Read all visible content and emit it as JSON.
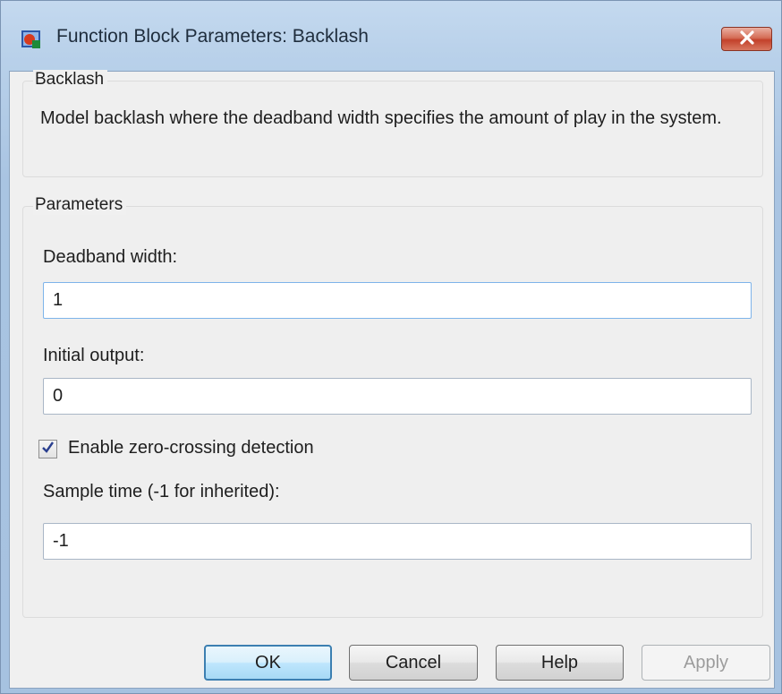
{
  "window": {
    "title": "Function Block Parameters: Backlash",
    "icon": "simulink-block-icon",
    "close_icon": "close-icon"
  },
  "description_group": {
    "label": "Backlash",
    "text": "Model backlash where the deadband width specifies the amount of play in the system."
  },
  "parameters_group": {
    "label": "Parameters",
    "deadband_width": {
      "label": "Deadband width:",
      "value": "1"
    },
    "initial_output": {
      "label": "Initial output:",
      "value": "0"
    },
    "zero_crossing": {
      "label": "Enable zero-crossing detection",
      "checked": true
    },
    "sample_time": {
      "label": "Sample time (-1 for inherited):",
      "value": "-1"
    }
  },
  "buttons": {
    "ok": "OK",
    "cancel": "Cancel",
    "help": "Help",
    "apply": "Apply"
  },
  "colors": {
    "close_button": "#c9452e",
    "default_button_border": "#3c7fb1",
    "focused_input_border": "#7eb4ea"
  }
}
